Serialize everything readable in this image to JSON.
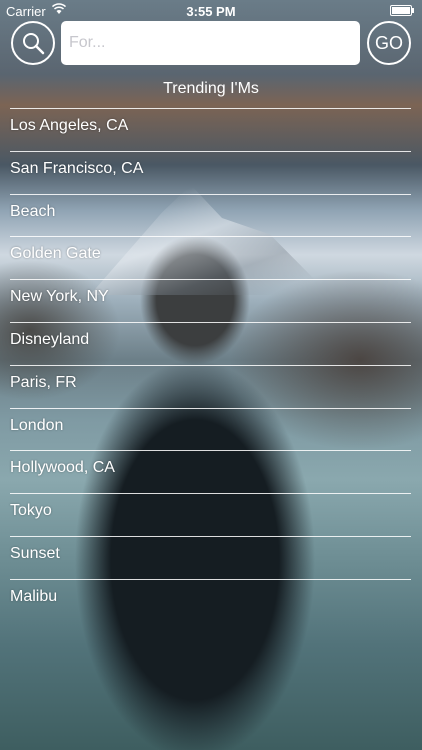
{
  "status_bar": {
    "carrier": "Carrier",
    "time": "3:55 PM",
    "icons": [
      "wifi-icon",
      "battery-icon"
    ]
  },
  "search": {
    "placeholder": "For...",
    "value": "",
    "search_icon": "search-icon",
    "go_label": "GO"
  },
  "trending": {
    "title": "Trending I'Ms",
    "items": [
      "Los Angeles, CA",
      "San Francisco, CA",
      "Beach",
      "Golden Gate",
      "New York, NY",
      "Disneyland",
      "Paris, FR",
      "London",
      "Hollywood, CA",
      "Tokyo",
      "Sunset",
      "Malibu"
    ]
  },
  "colors": {
    "text": "#ffffff",
    "field_background": "#ffffff",
    "placeholder": "#c7c7cd"
  }
}
